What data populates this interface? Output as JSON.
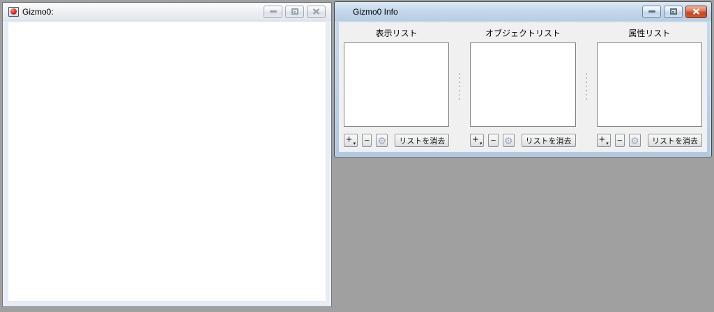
{
  "desktop": {
    "background_color": "#a0a0a0"
  },
  "icons": {
    "plus": "+",
    "minus": "−",
    "gear": "⚙",
    "dropdown": "▾"
  },
  "windows": {
    "gizmo": {
      "title": "Gizmo0:",
      "state": "inactive"
    },
    "gizmo_info": {
      "title": "Gizmo0 Info",
      "state": "active",
      "titlebar_color": "#b6cde4",
      "close_button_color": "#c64424",
      "panel_background": "#f0f0f0",
      "panels": [
        {
          "label": "表示リスト",
          "list_items": [],
          "clear_label": "リストを消去"
        },
        {
          "label": "オブジェクトリスト",
          "list_items": [],
          "clear_label": "リストを消去"
        },
        {
          "label": "属性リスト",
          "list_items": [],
          "clear_label": "リストを消去"
        }
      ]
    }
  }
}
